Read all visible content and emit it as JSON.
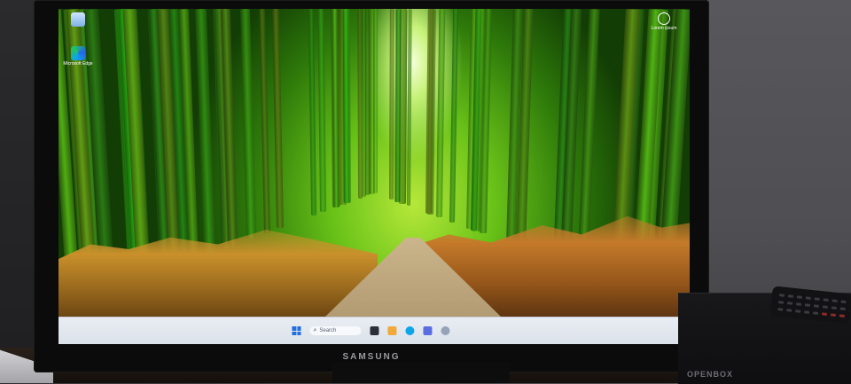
{
  "monitor": {
    "brand": "SAMSUNG"
  },
  "desktop_icons": [
    {
      "name": "recycle-bin",
      "label": ""
    },
    {
      "name": "microsoft-edge",
      "label": "Microsoft Edge"
    }
  ],
  "top_right_icon": {
    "label": "Lorem ipsum"
  },
  "taskbar": {
    "search_placeholder": "Search"
  },
  "settop_box": {
    "brand": "OPENBOX"
  },
  "colors": {
    "bamboo_green": "#3fa318",
    "grass": "#c9902b",
    "taskbar": "#e3e8ef",
    "accent": "#1f6fe0"
  }
}
